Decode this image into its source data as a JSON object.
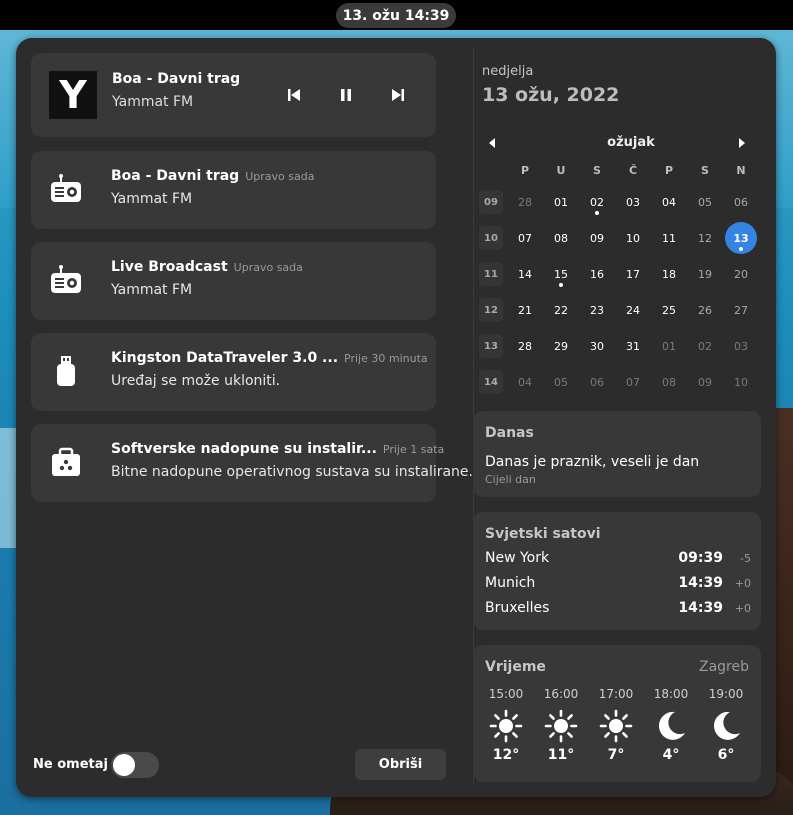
{
  "topbar": {
    "clock": "13. ožu  14:39"
  },
  "media": {
    "art_letter": "Y",
    "title": "Boa - Davni trag",
    "artist": "Yammat FM"
  },
  "notifications": [
    {
      "icon": "radio-icon",
      "title": "Boa - Davni trag",
      "time": "Upravo sada",
      "body": "Yammat FM"
    },
    {
      "icon": "radio-icon",
      "title": "Live Broadcast",
      "time": "Upravo sada",
      "body": "Yammat FM"
    },
    {
      "icon": "usb-drive-icon",
      "title": "Kingston DataTraveler 3.0 ...",
      "time": "Prije 30 minuta",
      "body": "Uređaj se može ukloniti."
    },
    {
      "icon": "software-update-icon",
      "title": "Softverske nadopune su instalir...",
      "time": "Prije 1 sata",
      "body": "Bitne nadopune operativnog sustava su instalirane."
    }
  ],
  "footer": {
    "dnd_label": "Ne ometaj",
    "dnd_enabled": false,
    "clear_label": "Obriši"
  },
  "date": {
    "weekday": "nedjelja",
    "full": "13 ožu, 2022"
  },
  "calendar": {
    "month": "ožujak",
    "weekdays": [
      "P",
      "U",
      "S",
      "Č",
      "P",
      "S",
      "N"
    ],
    "weeks": [
      {
        "num": "09",
        "days": [
          "28",
          "01",
          "02",
          "03",
          "04",
          "05",
          "06"
        ]
      },
      {
        "num": "10",
        "days": [
          "07",
          "08",
          "09",
          "10",
          "11",
          "12",
          "13"
        ]
      },
      {
        "num": "11",
        "days": [
          "14",
          "15",
          "16",
          "17",
          "18",
          "19",
          "20"
        ]
      },
      {
        "num": "12",
        "days": [
          "21",
          "22",
          "23",
          "24",
          "25",
          "26",
          "27"
        ]
      },
      {
        "num": "13",
        "days": [
          "28",
          "29",
          "30",
          "31",
          "01",
          "02",
          "03"
        ]
      },
      {
        "num": "14",
        "days": [
          "04",
          "05",
          "06",
          "07",
          "08",
          "09",
          "10"
        ]
      }
    ],
    "today": "13",
    "event_days": [
      "02",
      "13",
      "15"
    ]
  },
  "today_card": {
    "heading": "Danas",
    "event": "Danas je praznik, veseli je dan",
    "when": "Cijeli dan"
  },
  "world_clocks": {
    "heading": "Svjetski satovi",
    "rows": [
      {
        "city": "New York",
        "time": "09:39",
        "offset": "-5"
      },
      {
        "city": "Munich",
        "time": "14:39",
        "offset": "+0"
      },
      {
        "city": "Bruxelles",
        "time": "14:39",
        "offset": "+0"
      }
    ]
  },
  "weather": {
    "heading": "Vrijeme",
    "location": "Zagreb",
    "forecast": [
      {
        "hour": "15:00",
        "icon": "sun-icon",
        "temp": "12°"
      },
      {
        "hour": "16:00",
        "icon": "sun-icon",
        "temp": "11°"
      },
      {
        "hour": "17:00",
        "icon": "sun-icon",
        "temp": "7°"
      },
      {
        "hour": "18:00",
        "icon": "moon-icon",
        "temp": "4°"
      },
      {
        "hour": "19:00",
        "icon": "moon-icon",
        "temp": "6°"
      }
    ]
  },
  "colors": {
    "accent": "#3584e4",
    "panel": "#2c2c2c",
    "card": "#383838"
  }
}
